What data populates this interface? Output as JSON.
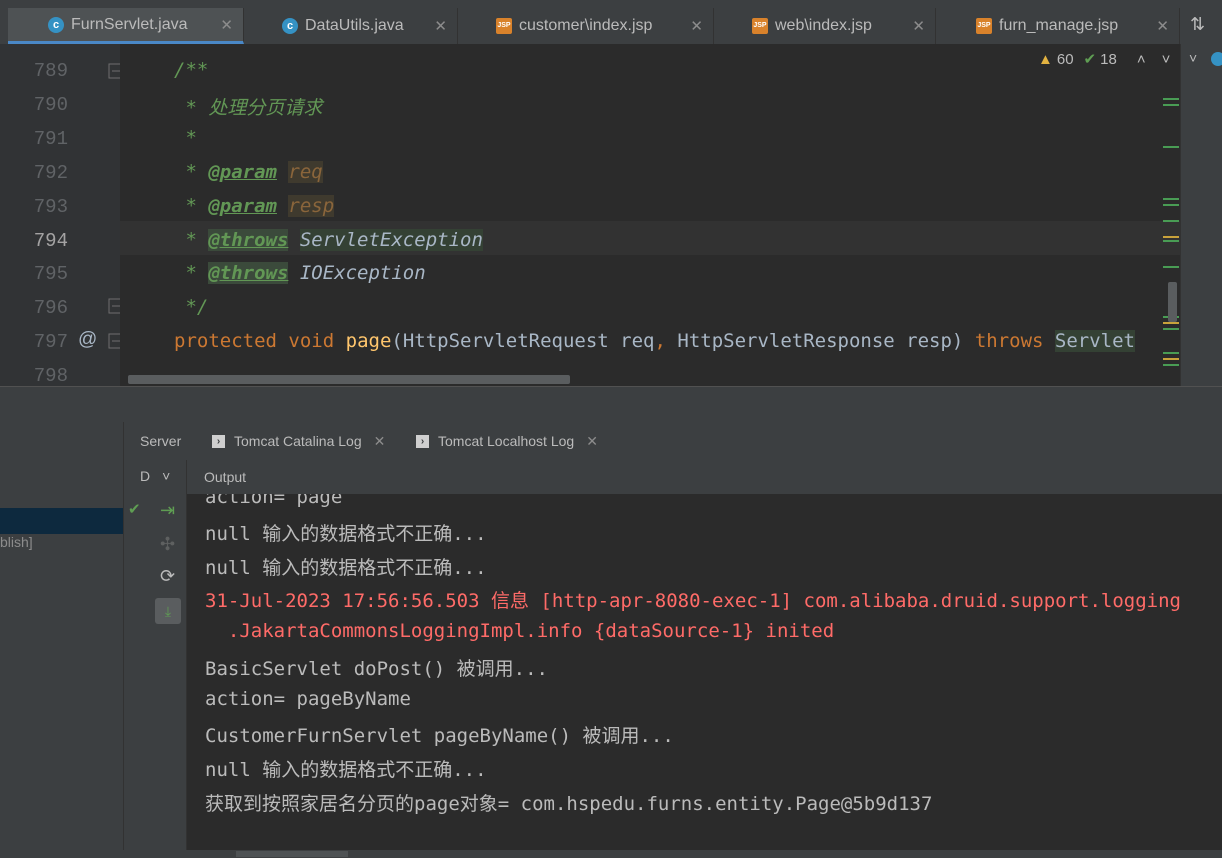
{
  "editor_tabs": [
    {
      "label": "FurnServlet.java",
      "icon": "java-class-icon",
      "active": true
    },
    {
      "label": "DataUtils.java",
      "icon": "java-class-icon",
      "active": false
    },
    {
      "label": "customer\\index.jsp",
      "icon": "jsp-file-icon",
      "active": false
    },
    {
      "label": "web\\index.jsp",
      "icon": "jsp-file-icon",
      "active": false
    },
    {
      "label": "furn_manage.jsp",
      "icon": "jsp-file-icon",
      "active": false
    }
  ],
  "inspections": {
    "warnings": "60",
    "ok": "18"
  },
  "line_numbers": [
    "789",
    "790",
    "791",
    "792",
    "793",
    "794",
    "795",
    "796",
    "797",
    "798"
  ],
  "gutter_annotation": "@",
  "code": {
    "l789": "/**",
    "l790_prefix": " * ",
    "l790_text": "处理分页请求",
    "l791": " *",
    "l792_prefix": " * ",
    "l792_tag": "@param",
    "l792_name": "req",
    "l793_prefix": " * ",
    "l793_tag": "@param",
    "l793_name": "resp",
    "l794_prefix": " * ",
    "l794_tag": "@throws",
    "l794_cls": "ServletException",
    "l795_prefix": " * ",
    "l795_tag": "@throws",
    "l795_cls": "IOException",
    "l796": " */",
    "l797_kw1": "protected",
    "l797_kw2": "void",
    "l797_fn": "page",
    "l797_args1": "(HttpServletRequest req",
    "l797_comma": ",",
    "l797_args2": " HttpServletResponse resp) ",
    "l797_kw3": "throws",
    "l797_tail": "Servlet"
  },
  "panel_tabs": [
    {
      "label": "Server",
      "icon": "",
      "closable": false
    },
    {
      "label": "Tomcat Catalina Log",
      "icon": "terminal-icon",
      "closable": true
    },
    {
      "label": "Tomcat Localhost Log",
      "icon": "terminal-icon",
      "closable": true
    }
  ],
  "left_panel": {
    "dropdown_label": "D",
    "publish_fragment": "blish]"
  },
  "output_header": "Output",
  "console_lines": [
    {
      "text": "action= page",
      "color": "normal"
    },
    {
      "text": "null 输入的数据格式不正确...",
      "color": "normal"
    },
    {
      "text": "null 输入的数据格式不正确...",
      "color": "normal"
    },
    {
      "text": "31-Jul-2023 17:56:56.503 信息 [http-apr-8080-exec-1] com.alibaba.druid.support.logging",
      "color": "red"
    },
    {
      "text": "  .JakartaCommonsLoggingImpl.info {dataSource-1} inited",
      "color": "red"
    },
    {
      "text": "BasicServlet doPost() 被调用...",
      "color": "normal"
    },
    {
      "text": "action= pageByName",
      "color": "normal"
    },
    {
      "text": "CustomerFurnServlet pageByName() 被调用...",
      "color": "normal"
    },
    {
      "text": "null 输入的数据格式不正确...",
      "color": "normal"
    },
    {
      "text": "获取到按照家居名分页的page对象= com.hspedu.furns.entity.Page@5b9d137",
      "color": "normal"
    }
  ]
}
